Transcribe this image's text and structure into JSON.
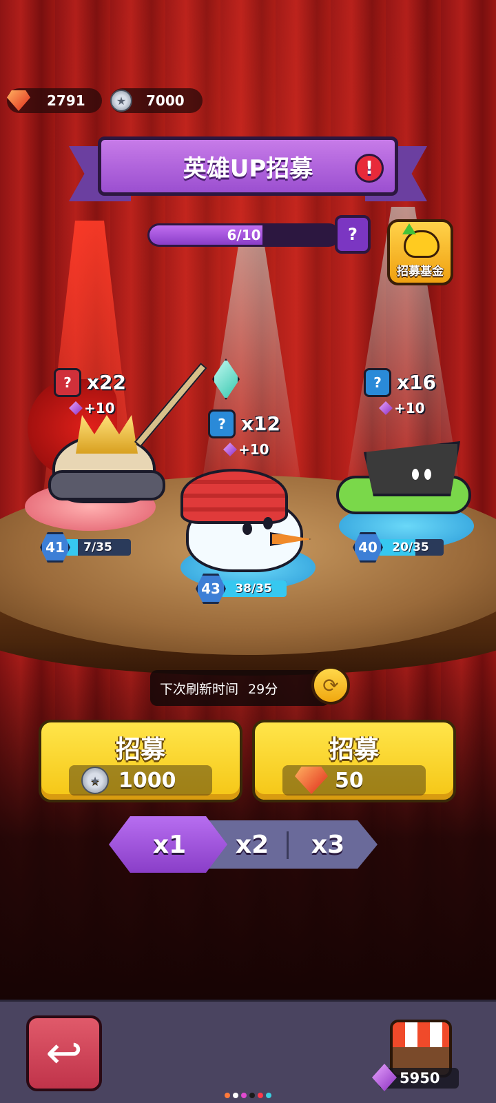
{
  "currencies": {
    "gems": "2791",
    "coins": "7000"
  },
  "banner": {
    "title": "英雄UP招募",
    "alert_symbol": "!"
  },
  "progress": {
    "label": "6/10",
    "current": 6,
    "max": 10,
    "help_symbol": "?"
  },
  "fund_button": {
    "label": "招募基金"
  },
  "heroes": [
    {
      "name": "hero-king",
      "count": "x22",
      "bonus": "+10",
      "level": "41",
      "shards": "7/35",
      "shard_fraction": 0.2,
      "badge_color": "#d0303a"
    },
    {
      "name": "hero-snowman",
      "count": "x12",
      "bonus": "+10",
      "level": "43",
      "shards": "38/35",
      "shard_fraction": 1.0,
      "badge_color": "#2a8ad8"
    },
    {
      "name": "hero-tank",
      "count": "x16",
      "bonus": "+10",
      "level": "40",
      "shards": "20/35",
      "shard_fraction": 0.57,
      "badge_color": "#2a8ad8"
    }
  ],
  "refresh": {
    "label": "下次刷新时间",
    "time": "29分"
  },
  "recruit_buttons": [
    {
      "title": "招募",
      "cost": "1000",
      "currency_icon": "coin-icon"
    },
    {
      "title": "招募",
      "cost": "50",
      "currency_icon": "gem-icon"
    }
  ],
  "multipliers": {
    "options": [
      "x1",
      "x2",
      "x3"
    ],
    "selected": "x1"
  },
  "bottom_bar": {
    "shop_gems": "5950"
  },
  "page_dots": [
    "#ff7a3a",
    "#ffffff",
    "#e04ad0",
    "#1a1a1a",
    "#ff3a4a",
    "#3ad0e0"
  ]
}
